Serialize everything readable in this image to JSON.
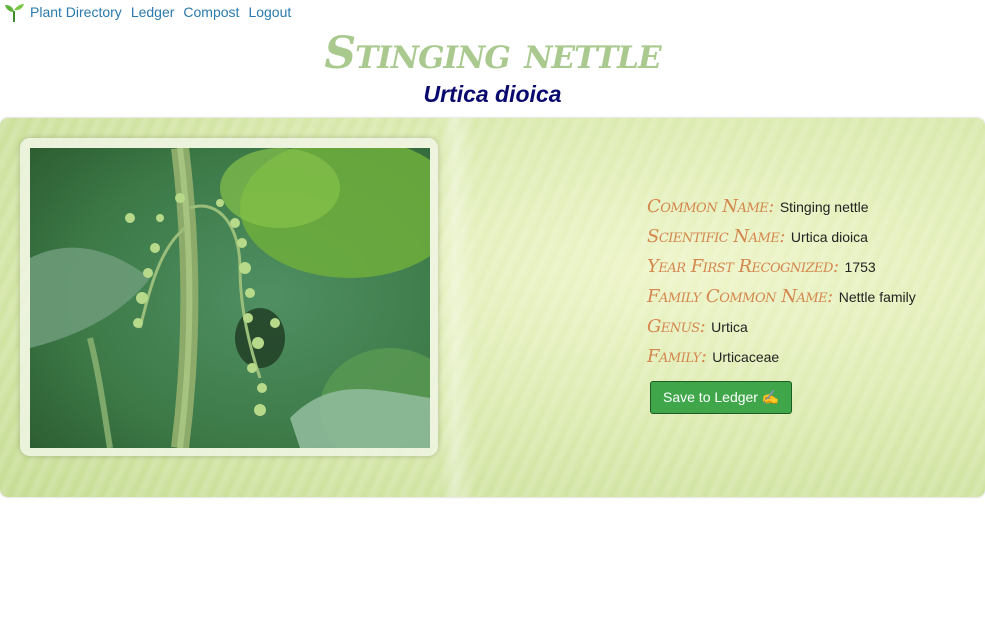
{
  "nav": {
    "links": [
      "Plant Directory",
      "Ledger",
      "Compost",
      "Logout"
    ]
  },
  "plant": {
    "common_name_title": "Stinging nettle",
    "scientific_name_title": "Urtica dioica"
  },
  "details": {
    "rows": [
      {
        "label": "Common Name:",
        "value": "Stinging nettle"
      },
      {
        "label": "Scientific Name:",
        "value": "Urtica dioica"
      },
      {
        "label": "Year First Recognized:",
        "value": "1753"
      },
      {
        "label": "Family Common Name:",
        "value": "Nettle family"
      },
      {
        "label": "Genus:",
        "value": "Urtica"
      },
      {
        "label": "Family:",
        "value": "Urticaceae"
      }
    ],
    "save_label": "Save to Ledger ✍️"
  },
  "colors": {
    "nav_link": "#2a7aaf",
    "title": "#a9c98f",
    "subtitle": "#0a0a6e",
    "label": "#d4874c",
    "button": "#3fa64a"
  },
  "icons": {
    "logo": "seedling-icon"
  }
}
